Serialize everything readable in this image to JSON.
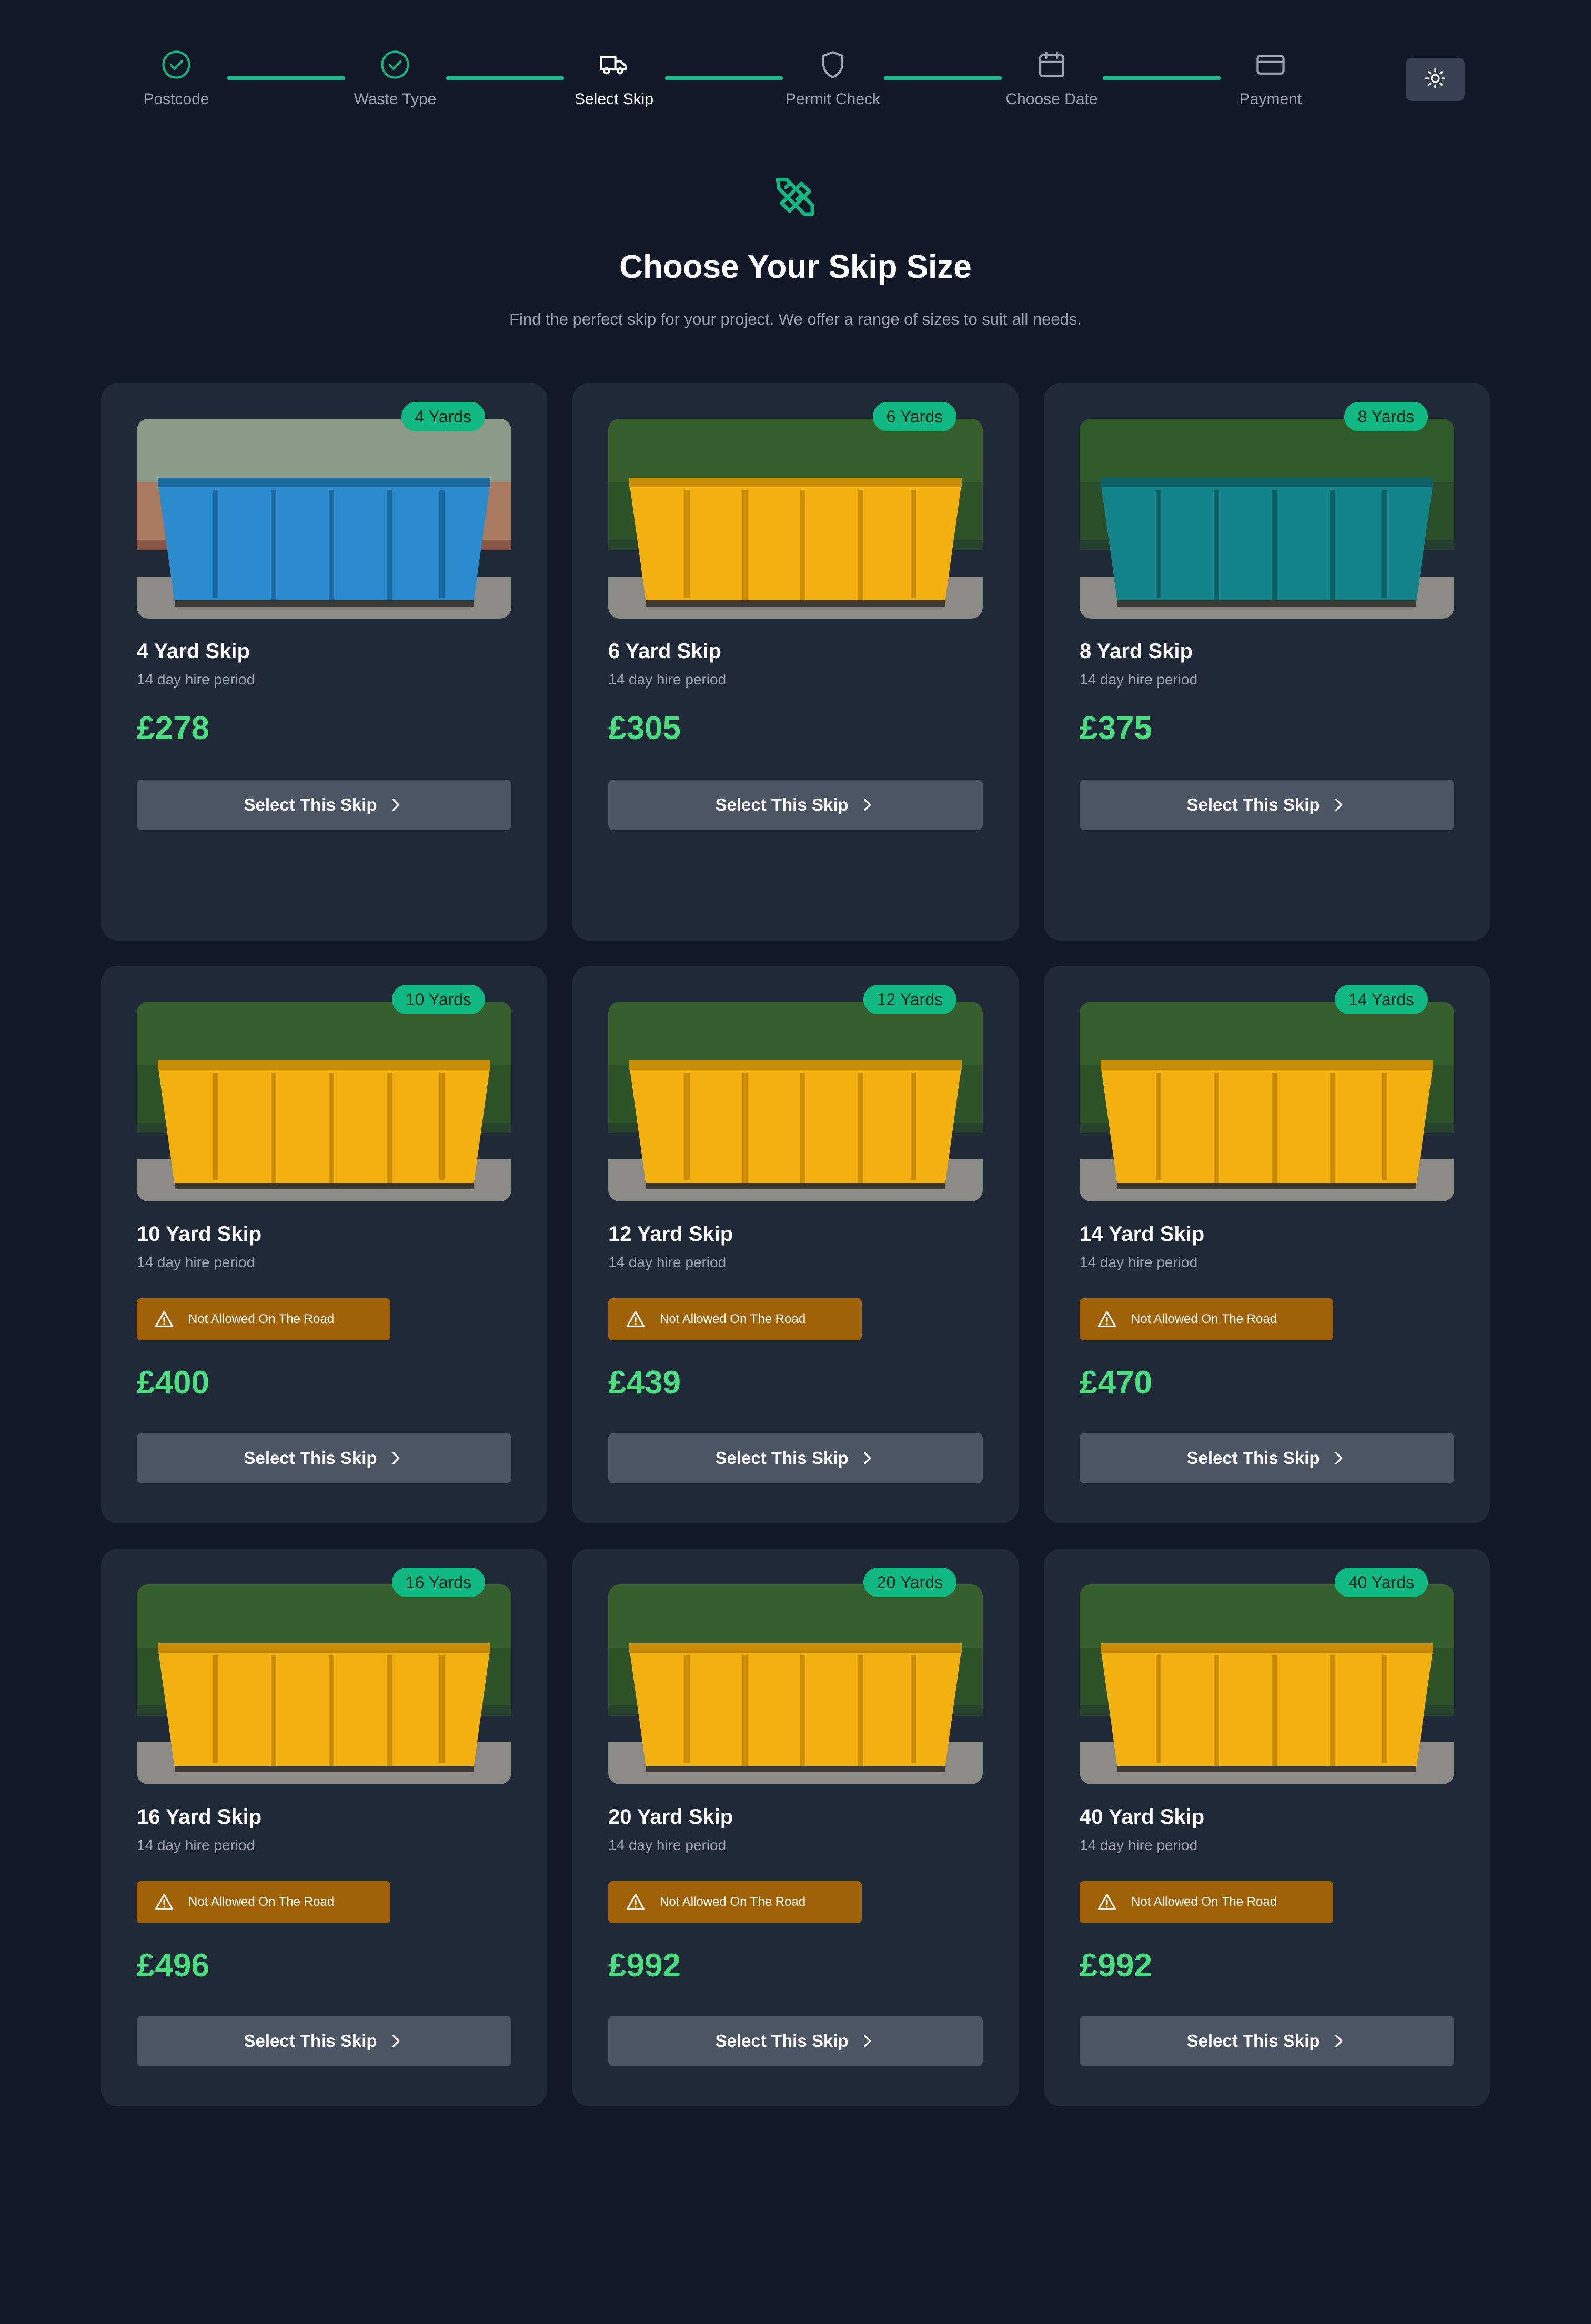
{
  "stepper": {
    "steps": [
      {
        "label": "Postcode",
        "icon": "check-circle-icon",
        "state": "done"
      },
      {
        "label": "Waste Type",
        "icon": "check-circle-icon",
        "state": "done"
      },
      {
        "label": "Select Skip",
        "icon": "truck-icon",
        "state": "active"
      },
      {
        "label": "Permit Check",
        "icon": "shield-icon",
        "state": "pending"
      },
      {
        "label": "Choose Date",
        "icon": "calendar-icon",
        "state": "pending"
      },
      {
        "label": "Payment",
        "icon": "credit-card-icon",
        "state": "pending"
      }
    ],
    "accent_color": "#10b981"
  },
  "theme_toggle": {
    "icon": "sun-icon"
  },
  "header": {
    "icon": "tools-icon",
    "title": "Choose Your Skip Size",
    "subtitle": "Find the perfect skip for your project. We offer a range of sizes to suit all needs."
  },
  "colors": {
    "background": "#111827",
    "card": "#1f2937",
    "price": "#4ade80",
    "badge": "#10b981",
    "warning": "#a16207",
    "button": "#4b5563"
  },
  "skips": [
    {
      "badge": "4 Yards",
      "title": "4 Yard Skip",
      "hire": "14 day hire period",
      "price": "£278",
      "button": "Select This Skip",
      "color": "blue"
    },
    {
      "badge": "6 Yards",
      "title": "6 Yard Skip",
      "hire": "14 day hire period",
      "price": "£305",
      "button": "Select This Skip",
      "color": "yellow"
    },
    {
      "badge": "8 Yards",
      "title": "8 Yard Skip",
      "hire": "14 day hire period",
      "price": "£375",
      "button": "Select This Skip",
      "color": "teal"
    },
    {
      "badge": "10 Yards",
      "title": "10 Yard Skip",
      "hire": "14 day hire period",
      "warning": "Not Allowed On The Road",
      "price": "£400",
      "button": "Select This Skip",
      "color": "yellow"
    },
    {
      "badge": "12 Yards",
      "title": "12 Yard Skip",
      "hire": "14 day hire period",
      "warning": "Not Allowed On The Road",
      "price": "£439",
      "button": "Select This Skip",
      "color": "yellow"
    },
    {
      "badge": "14 Yards",
      "title": "14 Yard Skip",
      "hire": "14 day hire period",
      "warning": "Not Allowed On The Road",
      "price": "£470",
      "button": "Select This Skip",
      "color": "yellow"
    },
    {
      "badge": "16 Yards",
      "title": "16 Yard Skip",
      "hire": "14 day hire period",
      "warning": "Not Allowed On The Road",
      "price": "£496",
      "button": "Select This Skip",
      "color": "yellow"
    },
    {
      "badge": "20 Yards",
      "title": "20 Yard Skip",
      "hire": "14 day hire period",
      "warning": "Not Allowed On The Road",
      "price": "£992",
      "button": "Select This Skip",
      "color": "yellow"
    },
    {
      "badge": "40 Yards",
      "title": "40 Yard Skip",
      "hire": "14 day hire period",
      "warning": "Not Allowed On The Road",
      "price": "£992",
      "button": "Select This Skip",
      "color": "yellow"
    }
  ]
}
